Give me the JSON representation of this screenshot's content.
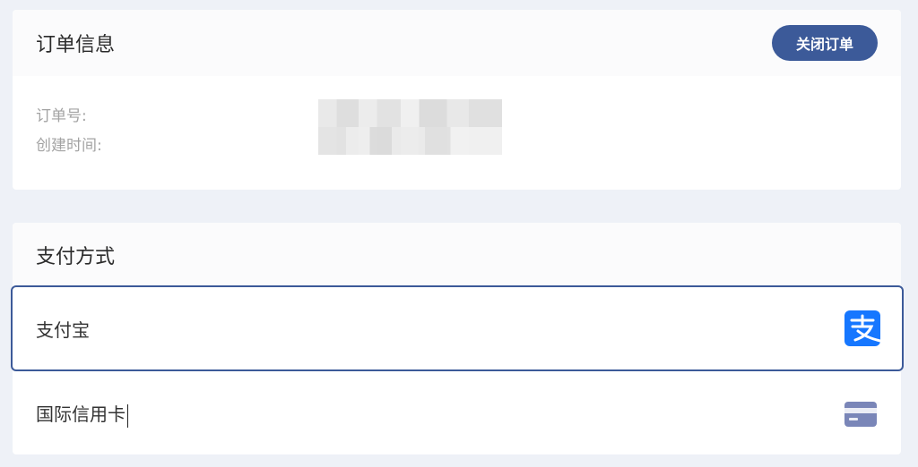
{
  "order": {
    "title": "订单信息",
    "close_label": "关闭订单",
    "order_no_label": "订单号:",
    "created_label": "创建时间:"
  },
  "payment": {
    "title": "支付方式",
    "options": [
      {
        "label": "支付宝",
        "icon": "alipay-icon",
        "selected": true
      },
      {
        "label": "国际信用卡",
        "icon": "credit-card-icon",
        "selected": false
      }
    ]
  },
  "colors": {
    "accent": "#3c5a99",
    "alipay": "#1677ff",
    "card_icon": "#7a86b8",
    "background": "#eef1f7"
  }
}
